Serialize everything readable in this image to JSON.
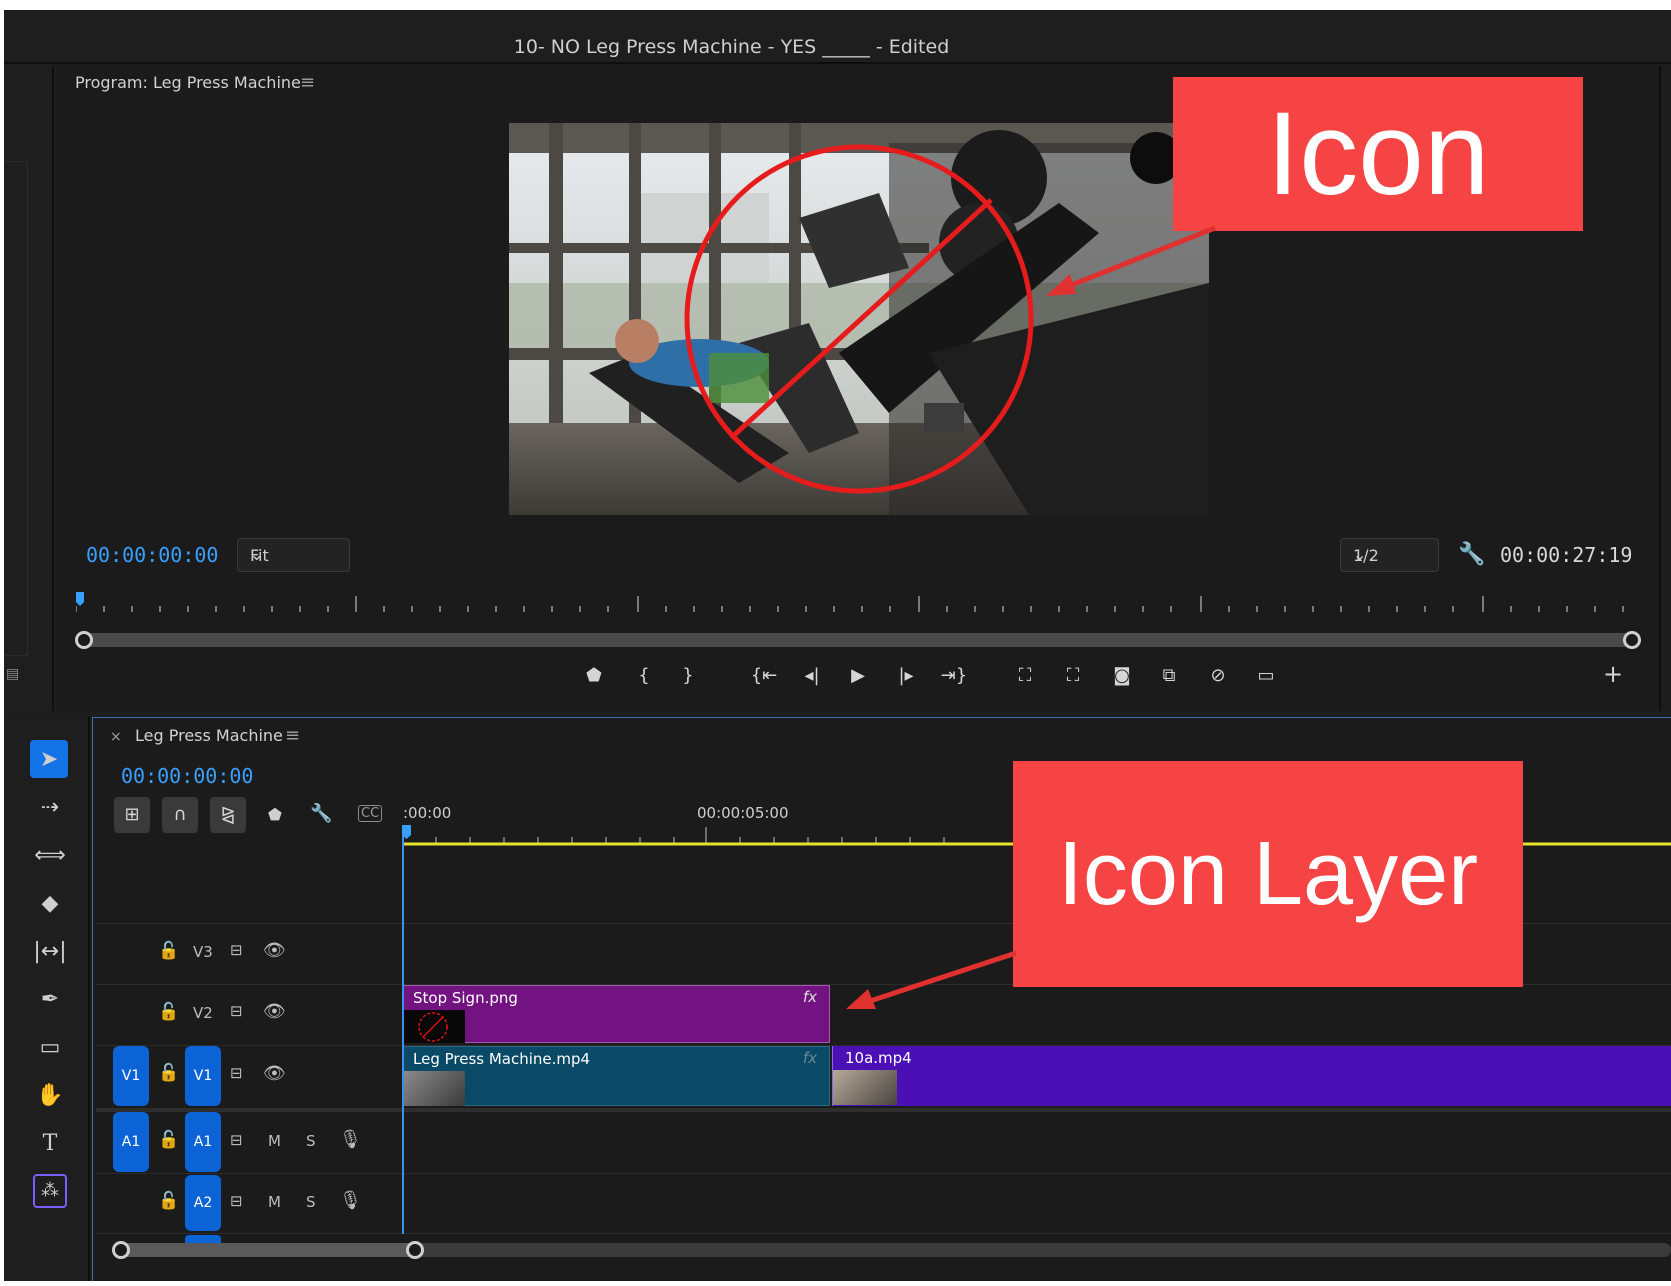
{
  "window": {
    "title": "10- NO Leg Press Machine - YES _____ - Edited"
  },
  "program_monitor": {
    "title": "Program: Leg Press Machine",
    "timecode_current": "00:00:00:00",
    "fit_label": "Fit",
    "resolution_label": "1/2",
    "timecode_duration": "00:00:27:19"
  },
  "timeline": {
    "sequence_name": "Leg Press Machine",
    "timecode": "00:00:00:00",
    "ruler": [
      ":00:00",
      "00:00:05:00"
    ],
    "tracks": {
      "v3": "V3",
      "v2": "V2",
      "v1": "V1",
      "a1": "A1",
      "a2": "A2",
      "v1_src": "V1",
      "a1_src": "A1",
      "mute": "M",
      "solo": "S"
    },
    "clips": {
      "stop_sign": "Stop Sign.png",
      "leg_press": "Leg Press Machine.mp4",
      "next": "10a.mp4",
      "fx": "fx"
    }
  },
  "annotations": {
    "icon": "Icon",
    "icon_layer": "Icon Layer"
  },
  "colors": {
    "timecode": "#3aa0ff",
    "callout": "#f64343",
    "clip_stop_sign": "#731281",
    "clip_leg_press": "#0a4a66",
    "clip_next": "#4a0fb5",
    "track_target": "#0c63d6"
  }
}
